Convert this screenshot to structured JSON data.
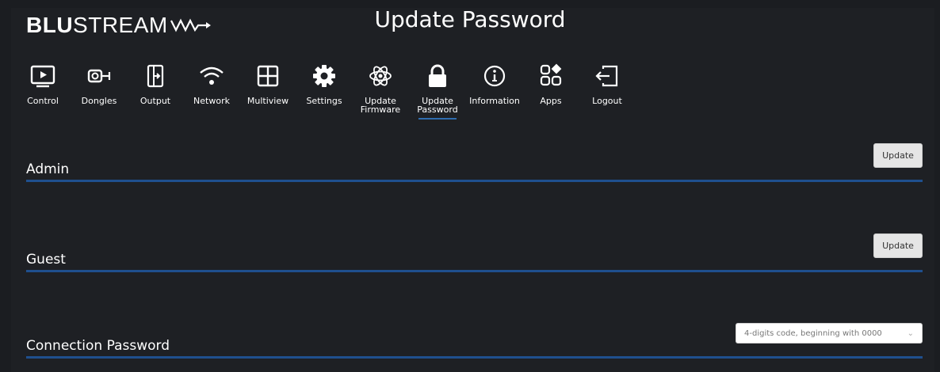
{
  "brand": {
    "bold": "BLU",
    "light": "STREAM"
  },
  "header": {
    "title": "Update Password"
  },
  "nav": [
    {
      "label": "Control",
      "icon": "monitor-play-icon",
      "active": false
    },
    {
      "label": "Dongles",
      "icon": "dongle-icon",
      "active": false
    },
    {
      "label": "Output",
      "icon": "output-icon",
      "active": false
    },
    {
      "label": "Network",
      "icon": "wifi-icon",
      "active": false
    },
    {
      "label": "Multiview",
      "icon": "grid-icon",
      "active": false
    },
    {
      "label": "Settings",
      "icon": "gear-icon",
      "active": false
    },
    {
      "label": "Update\nFirmware",
      "icon": "atom-icon",
      "active": false
    },
    {
      "label": "Update\nPassword",
      "icon": "lock-icon",
      "active": true
    },
    {
      "label": "Information",
      "icon": "info-icon",
      "active": false
    },
    {
      "label": "Apps",
      "icon": "apps-icon",
      "active": false
    },
    {
      "label": "Logout",
      "icon": "logout-icon",
      "active": false
    }
  ],
  "sections": {
    "admin": {
      "title": "Admin",
      "button": "Update"
    },
    "guest": {
      "title": "Guest",
      "button": "Update"
    },
    "connection": {
      "title": "Connection Password",
      "select_value": "4-digits code, beginning with 0000"
    }
  },
  "colors": {
    "accent": "#2f6db0",
    "rule": "#1f4f8e",
    "background": "#1e2024"
  }
}
